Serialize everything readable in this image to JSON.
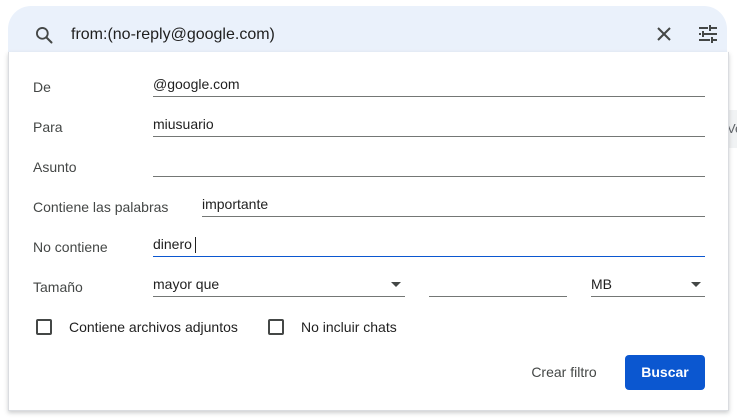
{
  "search": {
    "query": "from:(no-reply@google.com)"
  },
  "side_peek": {
    "text": "Ve"
  },
  "form": {
    "from_label": "De",
    "from_value": "@google.com",
    "to_label": "Para",
    "to_value": "miusuario",
    "subject_label": "Asunto",
    "subject_value": "",
    "has_words_label": "Contiene las palabras",
    "has_words_value": "importante",
    "doesnt_have_label": "No contiene",
    "doesnt_have_value": "dinero",
    "size_label": "Tamaño",
    "size_operator": "mayor que",
    "size_value": "",
    "size_unit": "MB",
    "has_attachment_label": "Contiene archivos adjuntos",
    "has_attachment_checked": false,
    "exclude_chats_label": "No incluir chats",
    "exclude_chats_checked": false
  },
  "actions": {
    "create_filter_label": "Crear filtro",
    "search_label": "Buscar"
  },
  "colors": {
    "search_bar_bg": "#eaf1fb",
    "primary": "#0b57d0"
  }
}
